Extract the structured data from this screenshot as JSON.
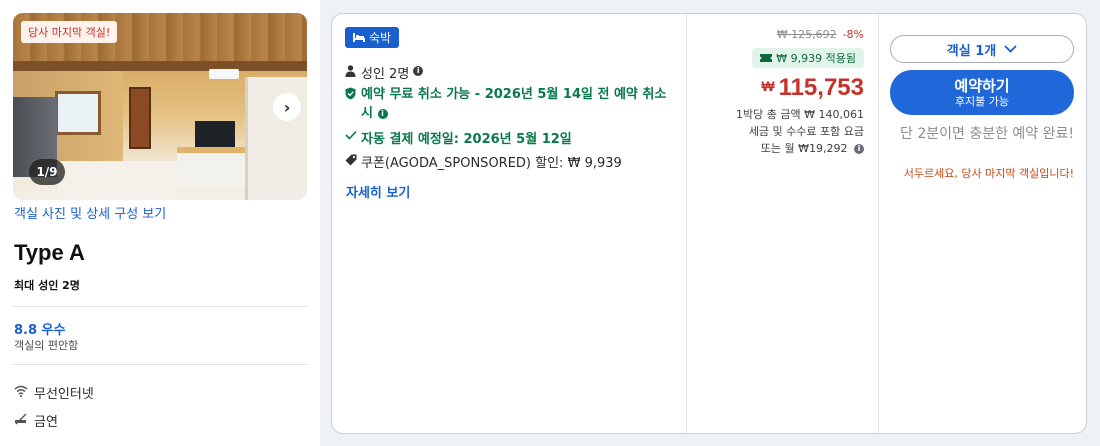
{
  "photo": {
    "badge": "당사 마지막 객실!",
    "counter": "1/9",
    "next_arrow": "›",
    "link": "객실 사진 및 상세 구성 보기"
  },
  "room": {
    "name": "Type A",
    "occupancy": "최대 성인 2명",
    "rating": "8.8 우수",
    "rating_caption": "객실의 편안함",
    "amenities": [
      {
        "icon": "wifi-icon",
        "label": "무선인터넷"
      },
      {
        "icon": "no-smoking-icon",
        "label": "금연"
      }
    ]
  },
  "offer": {
    "tag": "숙박",
    "adults": "성인 2명",
    "free_cancel": "예약 무료 취소 가능 - 2026년 5월 14일 전 예약 취소 시",
    "auto_pay": "자동 결제 예정일: 2026년 5월 12일",
    "coupon_prefix": "쿠폰(AGODA_SPONSORED) 할인: ",
    "coupon_amount": "₩ 9,939",
    "details_link": "자세히 보기"
  },
  "price": {
    "original": "₩ 125,692",
    "discount": "-8%",
    "coupon_applied": "₩ 9,939 적용됨",
    "currency": "₩",
    "amount": "115,753",
    "per_night_total": "1박당 총 금액 ₩ 140,061",
    "taxes": "세금 및 수수료 포함 요금",
    "monthly": "또는 월 ₩19,292"
  },
  "action": {
    "room_count": "객실 1개",
    "book_label": "예약하기",
    "book_sub": "후지불 가능",
    "urgency": "단 2분이면 충분한 예약 완료!",
    "scarcity": "서두르세요, 당사 마지막 객실입니다!"
  },
  "colors": {
    "accent_blue": "#1a5fcf",
    "price_red": "#c6322b",
    "green": "#08794a",
    "scarcity_orange": "#c44a14"
  }
}
